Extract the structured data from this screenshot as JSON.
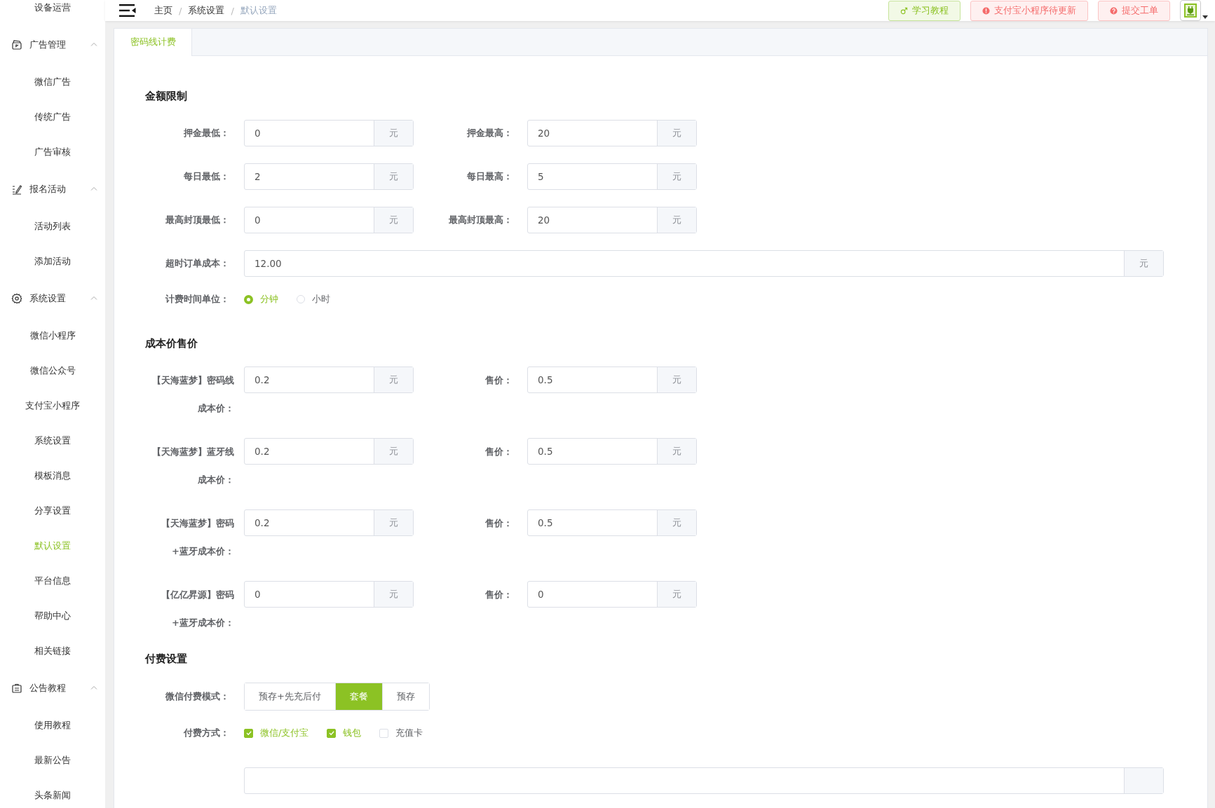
{
  "sidebar": {
    "items": [
      {
        "label": "设备运营",
        "selected": false
      },
      {
        "label": "广告管理",
        "expanded": true,
        "children": [
          {
            "label": "微信广告",
            "selected": false
          },
          {
            "label": "传统广告",
            "selected": false
          },
          {
            "label": "广告审核",
            "selected": false
          }
        ]
      },
      {
        "label": "报名活动",
        "expanded": true,
        "children": [
          {
            "label": "活动列表",
            "selected": false
          },
          {
            "label": "添加活动",
            "selected": false
          }
        ]
      },
      {
        "label": "系统设置",
        "expanded": true,
        "children": [
          {
            "label": "微信小程序",
            "selected": false
          },
          {
            "label": "微信公众号",
            "selected": false
          },
          {
            "label": "支付宝小程序",
            "selected": false
          },
          {
            "label": "系统设置",
            "selected": false
          },
          {
            "label": "模板消息",
            "selected": false
          },
          {
            "label": "分享设置",
            "selected": false
          },
          {
            "label": "默认设置",
            "selected": true
          },
          {
            "label": "平台信息",
            "selected": false
          },
          {
            "label": "帮助中心",
            "selected": false
          },
          {
            "label": "相关链接",
            "selected": false
          }
        ]
      },
      {
        "label": "公告教程",
        "expanded": true,
        "children": [
          {
            "label": "使用教程",
            "selected": false
          },
          {
            "label": "最新公告",
            "selected": false
          },
          {
            "label": "头条新闻",
            "selected": false
          }
        ]
      }
    ]
  },
  "breadcrumb": [
    {
      "kind": "link",
      "text": "主页"
    },
    {
      "kind": "separator",
      "text": "/"
    },
    {
      "kind": "link",
      "text": "系统设置"
    },
    {
      "kind": "separator",
      "text": "/"
    },
    {
      "kind": "current",
      "text": "默认设置"
    }
  ],
  "header_buttons": [
    {
      "kind": "tutorial",
      "label": "学习教程"
    },
    {
      "kind": "warning",
      "label": "支付宝小程序待更新"
    },
    {
      "kind": "help",
      "label": "提交工单"
    }
  ],
  "tabs": [
    {
      "label": "密码线计费",
      "selected": true
    }
  ],
  "amount_limits": {
    "title": "金额限制",
    "pairs": [
      [
        {
          "label": "押金最低：",
          "value": "0",
          "unit": "元"
        },
        {
          "label": "押金最高：",
          "value": "20",
          "unit": "元"
        }
      ],
      [
        {
          "label": "每日最低：",
          "value": "2",
          "unit": "元"
        },
        {
          "label": "每日最高：",
          "value": "5",
          "unit": "元"
        }
      ],
      [
        {
          "label": "最高封顶最低：",
          "value": "0",
          "unit": "元"
        },
        {
          "label": "最高封顶最高：",
          "value": "20",
          "unit": "元"
        }
      ]
    ],
    "timeout_cost": {
      "label": "超时订单成本：",
      "value": "12.00",
      "unit": "元"
    },
    "time_unit": {
      "label": "计费时间单位：",
      "options": [
        {
          "label": "分钟",
          "selected": true
        },
        {
          "label": "小时",
          "selected": false
        }
      ]
    }
  },
  "cost_price": {
    "title": "成本价售价",
    "rows": [
      {
        "cost": {
          "label_lines": [
            "【天海蓝梦】密码线",
            "成本价："
          ],
          "value": "0.2",
          "unit": "元"
        },
        "sale": {
          "label": "售价：",
          "value": "0.5",
          "unit": "元"
        }
      },
      {
        "cost": {
          "label_lines": [
            "【天海蓝梦】蓝牙线",
            "成本价："
          ],
          "value": "0.2",
          "unit": "元"
        },
        "sale": {
          "label": "售价：",
          "value": "0.5",
          "unit": "元"
        }
      },
      {
        "cost": {
          "label_lines": [
            "【天海蓝梦】密码",
            "+蓝牙成本价："
          ],
          "value": "0.2",
          "unit": "元"
        },
        "sale": {
          "label": "售价：",
          "value": "0.5",
          "unit": "元"
        }
      },
      {
        "cost": {
          "label_lines": [
            "【亿亿昇源】密码",
            "+蓝牙成本价："
          ],
          "value": "0",
          "unit": "元"
        },
        "sale": {
          "label": "售价：",
          "value": "0",
          "unit": "元"
        }
      }
    ]
  },
  "payment": {
    "title": "付费设置",
    "wechat_mode": {
      "label": "微信付费模式：",
      "options": [
        {
          "label": "预存+先充后付",
          "selected": false
        },
        {
          "label": "套餐",
          "selected": true
        },
        {
          "label": "预存",
          "selected": false
        }
      ]
    },
    "methods": {
      "label": "付费方式：",
      "options": [
        {
          "label": "微信/支付宝",
          "checked": true
        },
        {
          "label": "钱包",
          "checked": true
        },
        {
          "label": "充值卡",
          "checked": false
        }
      ]
    }
  }
}
